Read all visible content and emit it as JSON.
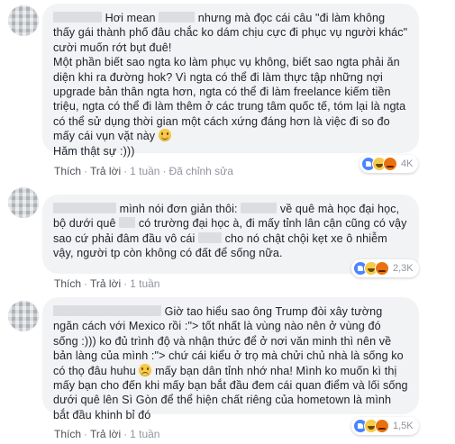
{
  "comments": [
    {
      "name": "",
      "lines": [
        "Hơi mean",
        "nhưng mà đọc cái câu \"đi làm không thấy gái thành phố đâu chắc ko dám chịu cực đi phục vụ người khác\" cười muốn rớt bụt đuê!",
        "Một phần biết sao ngta ko làm phục vụ không, biết sao ngta phải ăn diện khi ra đường hok? Vì ngta có thể đi làm thực tập những nợi upgrade bản thân ngta hơn, ngta có thể đi làm freelance kiếm tiền triệu, ngta có thể đi làm thêm ở các trung tâm quốc tế, tóm lại là ngta có thể sử dụng thời gian một cách xứng đáng hơn là việc đi so đo mấy cái vụn vặt này",
        "Hăm thật sự :)))"
      ],
      "actions": {
        "like": "Thích",
        "reply": "Trả lời",
        "time": "1 tuần",
        "edited": "Đã chỉnh sửa"
      },
      "reaction_count": "4K",
      "reaction_icons": [
        "like-icon",
        "haha-icon",
        "angry-icon"
      ]
    },
    {
      "name": "",
      "lines": [
        "mình nói đơn giản thôi:",
        "về quê mà học đại học, bộ dưới quê",
        "có trường đại học à, đi mấy tỉnh lân cận cũng có vậy sao cứ phải đâm đầu vô cái",
        "cho nó chật chội kẹt xe ô nhiễm vậy, người tp còn không có đất để sống nữa."
      ],
      "actions": {
        "like": "Thích",
        "reply": "Trả lời",
        "time": "1 tuần"
      },
      "reaction_count": "2,3K",
      "reaction_icons": [
        "like-icon",
        "haha-icon",
        "angry-icon"
      ]
    },
    {
      "name": "",
      "lines": [
        "Giờ tao hiểu sao ông Trump đòi xây tường ngăn cách với Mexico rồi :\"> tốt nhất là vùng nào nên ở vùng đó sống :))) ko đủ trình độ và nhận thức để ở nơi văn minh thì nên về bản làng của mình :\"> chứ cái kiểu ở trọ mà chửi chủ nhà là sống ko có thọ đâu huhu",
        "mấy bạn dân tỉnh nhớ nha! Mình ko muốn kì thị mấy bạn cho đến khi mấy bạn bắt đầu đem cái quan điểm và lối sống dưới quê lên Sì Gòn để thể hiện chất riêng của hometown là mình bắt đầu khinh bỉ đó"
      ],
      "actions": {
        "like": "Thích",
        "reply": "Trả lời",
        "time": "1 tuần"
      },
      "reaction_count": "1,5K",
      "reaction_icons": [
        "like-icon",
        "haha-icon",
        "angry-icon"
      ]
    }
  ]
}
